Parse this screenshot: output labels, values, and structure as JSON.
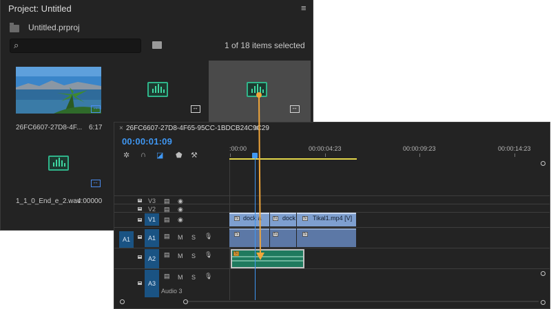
{
  "project": {
    "title": "Project: Untitled",
    "filename": "Untitled.prproj",
    "search_placeholder": "",
    "item_count": "1 of 18 items selected",
    "items": [
      {
        "name": "26FC6607-27D8-4F...",
        "duration": "6:17",
        "kind": "video",
        "selected": false
      },
      {
        "name": "",
        "duration": "",
        "kind": "audio",
        "selected": false
      },
      {
        "name": "",
        "duration": "",
        "kind": "audio",
        "selected": true
      },
      {
        "name": "1_1_0_End_e_2.wav",
        "duration": "4:00000",
        "kind": "audio",
        "selected": false
      }
    ]
  },
  "timeline": {
    "sequence_name": "26FC6607-27D8-4F65-95CC-1BDCB24C9C29",
    "timecode": "00:00:01:09",
    "ruler": [
      ":00:00",
      "00:00:04:23",
      "00:00:09:23",
      "00:00:14:23"
    ],
    "tracks": {
      "video": [
        {
          "id": "V3"
        },
        {
          "id": "V2"
        },
        {
          "id": "V1",
          "source": "V1"
        }
      ],
      "audio": [
        {
          "id": "A1",
          "source": "A1"
        },
        {
          "id": "A2"
        },
        {
          "id": "A3",
          "name": "Audio 3"
        }
      ],
      "controls": {
        "mute": "M",
        "solo": "S"
      }
    },
    "video_clips": [
      {
        "label": "dock a"
      },
      {
        "label": "dock"
      },
      {
        "label": "Tikal1.mp4 [V]"
      }
    ]
  },
  "colors": {
    "accent": "#3f97f3",
    "drag_arrow": "#f2a73b",
    "audio_clip": "#1f7a5e",
    "video_clip": "#7e9fcf"
  }
}
